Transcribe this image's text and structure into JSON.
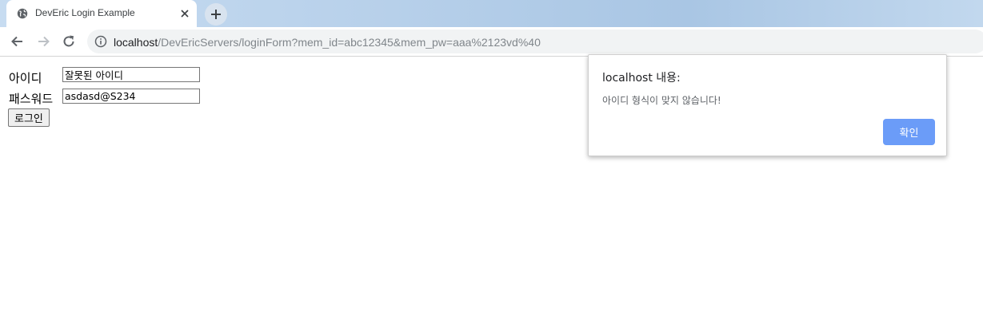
{
  "browser": {
    "tab_title": "DevEric Login Example",
    "url_host": "localhost",
    "url_path": "/DevEricServers/loginForm?mem_id=abc12345&mem_pw=aaa%2123vd%40"
  },
  "form": {
    "id_label": "아이디",
    "id_value": "잘못된 아이디",
    "pw_label": "패스워드",
    "pw_value": "asdasd@S234",
    "login_label": "로그인"
  },
  "alert": {
    "title": "localhost 내용:",
    "message": "아이디 형식이 맞지 않습니다!",
    "ok_label": "확인"
  },
  "icons": {
    "favicon": "globe-icon",
    "close": "close-icon",
    "new_tab": "plus-icon",
    "back": "back-arrow-icon",
    "forward": "forward-arrow-icon",
    "reload": "reload-icon",
    "site_info": "info-icon"
  },
  "colors": {
    "alert_button": "#6b9cf8",
    "omnibox_bg": "#f1f3f4"
  }
}
